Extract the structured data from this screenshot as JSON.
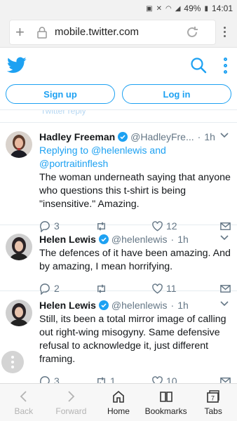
{
  "status_bar": {
    "battery": "49%",
    "time": "14:01"
  },
  "browser": {
    "url": "mobile.twitter.com"
  },
  "auth": {
    "signup_label": "Sign up",
    "login_label": "Log in"
  },
  "timeline": {
    "cutoff_text": "Twitter reply",
    "tweets": [
      {
        "name": "Hadley Freeman",
        "handle": "@HadleyFre...",
        "time": "1h",
        "replying_prefix": "Replying to",
        "replying_1": "@helenlewis",
        "replying_and": "and",
        "replying_2": "@portraitinflesh",
        "text": "The woman underneath saying that anyone who questions this t-shirt is being \"insensitive.\" Amazing.",
        "replies": "3",
        "retweets": "",
        "likes": "12"
      },
      {
        "name": "Helen Lewis",
        "handle": "@helenlewis",
        "time": "1h",
        "text": "The defences of it have been amazing. And by amazing, I mean horrifying.",
        "replies": "2",
        "retweets": "",
        "likes": "11"
      },
      {
        "name": "Helen Lewis",
        "handle": "@helenlewis",
        "time": "1h",
        "text": "Still, its been a total mirror image of calling out right-wing misogyny. Same defensive refusal to acknowledge it, just different framing.",
        "replies": "3",
        "retweets": "1",
        "likes": "10"
      }
    ]
  },
  "toolbar": {
    "back": "Back",
    "forward": "Forward",
    "home": "Home",
    "bookmarks": "Bookmarks",
    "tabs": "Tabs",
    "tabs_count": "7"
  },
  "colors": {
    "twitter_blue": "#1da1f2",
    "secondary_text": "#657786"
  }
}
